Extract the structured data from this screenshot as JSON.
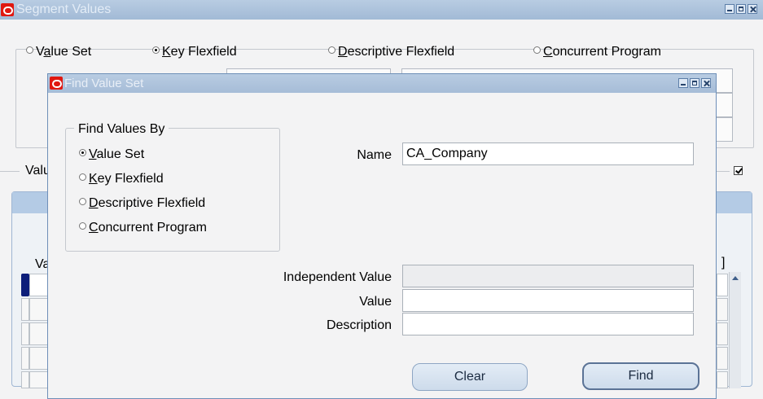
{
  "background_window": {
    "title": "Segment Values",
    "radio_options": [
      {
        "label": "Value Set",
        "underline": "a",
        "selected": false
      },
      {
        "label": "Key Flexfield",
        "underline": "K",
        "selected": true
      },
      {
        "label": "Descriptive Flexfield",
        "underline": "D",
        "selected": false
      },
      {
        "label": "Concurrent Program",
        "underline": "C",
        "selected": false
      }
    ],
    "partial_label_values": "Valu",
    "partial_column_header": "Va",
    "bracket": "]"
  },
  "dialog": {
    "title": "Find Value Set",
    "find_values_by": {
      "title": "Find Values By",
      "options": [
        {
          "label": "Value Set",
          "selected": true
        },
        {
          "label": "Key Flexfield",
          "selected": false
        },
        {
          "label": "Descriptive Flexfield",
          "selected": false
        },
        {
          "label": "Concurrent Program",
          "selected": false
        }
      ]
    },
    "fields": {
      "name": {
        "label": "Name",
        "value": "CA_Company"
      },
      "independent_value": {
        "label": "Independent Value",
        "value": ""
      },
      "value": {
        "label": "Value",
        "value": ""
      },
      "description": {
        "label": "Description",
        "value": ""
      }
    },
    "buttons": {
      "clear": "Clear",
      "find": "Find"
    }
  },
  "icons": {
    "app_logo": "oracle-logo-icon",
    "minimize": "minimize-icon",
    "maximize": "maximize-icon",
    "close": "close-icon"
  },
  "colors": {
    "titlebar": "#a2bad6",
    "logo": "#e01810",
    "background": "#f3f3f4"
  }
}
